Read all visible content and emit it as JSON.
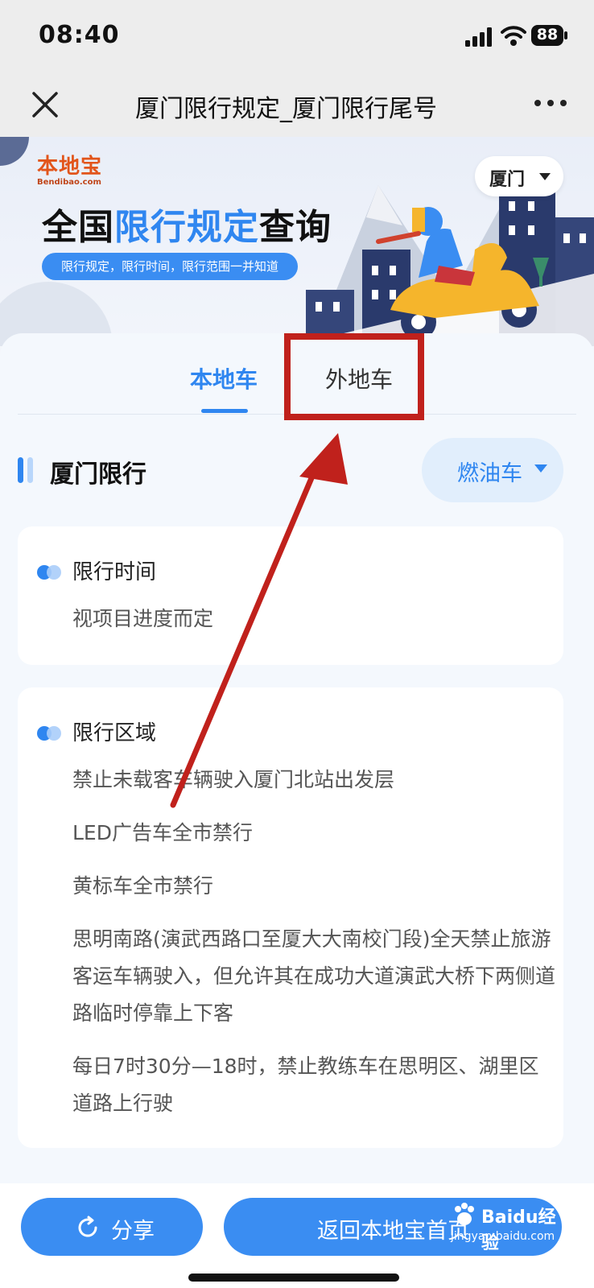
{
  "status_bar": {
    "time": "08:40",
    "battery": "88"
  },
  "nav": {
    "title": "厦门限行规定_厦门限行尾号"
  },
  "banner": {
    "logo_text": "本地宝",
    "logo_sub": "Bendibao.com",
    "heading_prefix": "全国",
    "heading_highlight": "限行规定",
    "heading_suffix": "查询",
    "tagline": "限行规定，限行时间，限行范围一并知道",
    "city": "厦门"
  },
  "tabs": [
    {
      "label": "本地车",
      "active": true
    },
    {
      "label": "外地车",
      "active": false
    }
  ],
  "section": {
    "title": "厦门限行",
    "fuel_type": "燃油车"
  },
  "cards": {
    "time": {
      "heading": "限行时间",
      "text": "视项目进度而定"
    },
    "area": {
      "heading": "限行区域",
      "items": [
        "禁止未载客车辆驶入厦门北站出发层",
        "LED广告车全市禁行",
        "黄标车全市禁行",
        "思明南路(演武西路口至厦大大南校门段)全天禁止旅游客运车辆驶入，但允许其在成功大道演武大桥下两侧道路临时停靠上下客",
        "每日7时30分—18时，禁止教练车在思明区、湖里区道路上行驶"
      ]
    }
  },
  "bottom": {
    "share_label": "分享",
    "home_label": "返回本地宝首页"
  },
  "watermark": {
    "brand": "Baidu经验",
    "url": "jingyan.baidu.com"
  },
  "colors": {
    "accent": "#2f86f0",
    "annotation": "#c0211c"
  }
}
